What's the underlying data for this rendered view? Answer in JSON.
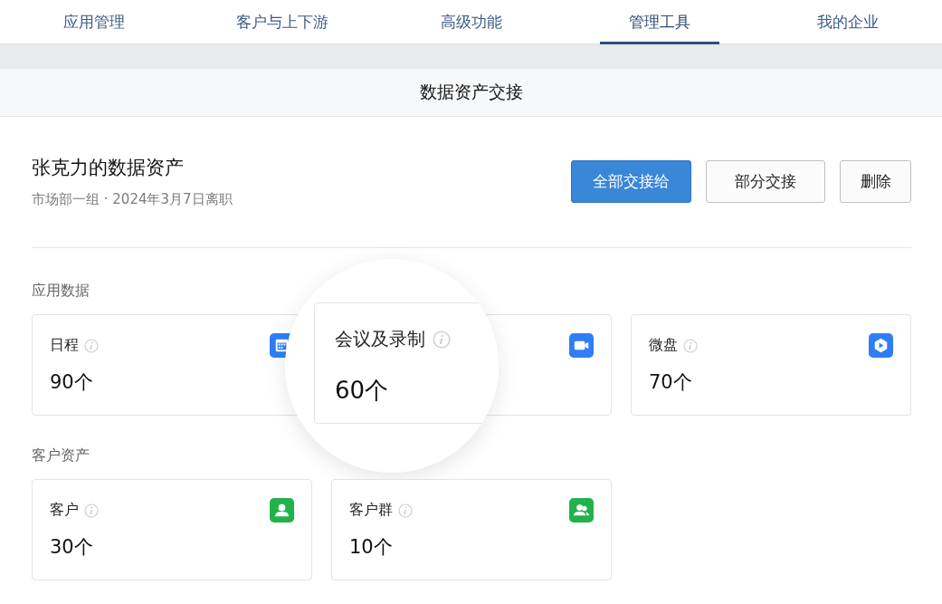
{
  "tabs": [
    {
      "label": "应用管理",
      "selected": false
    },
    {
      "label": "客户与上下游",
      "selected": false
    },
    {
      "label": "高级功能",
      "selected": false
    },
    {
      "label": "管理工具",
      "selected": true
    },
    {
      "label": "我的企业",
      "selected": false
    }
  ],
  "page_title": "数据资产交接",
  "owner": {
    "name": "张克力的数据资产",
    "subtitle": "市场部一组 · 2024年3月7日离职"
  },
  "actions": [
    {
      "label": "全部交接给",
      "kind": "primary"
    },
    {
      "label": "部分交接",
      "kind": "default"
    },
    {
      "label": "删除",
      "kind": "default"
    }
  ],
  "sections": [
    {
      "title": "应用数据",
      "cards": [
        {
          "label": "日程",
          "count": "90个",
          "kind": "calendar",
          "magnified": false
        },
        {
          "label": "会议及录制",
          "count": "60个",
          "kind": "video",
          "magnified": true
        },
        {
          "label": "微盘",
          "count": "70个",
          "kind": "drive",
          "magnified": false
        }
      ]
    },
    {
      "title": "客户资产",
      "cards": [
        {
          "label": "客户",
          "count": "30个",
          "kind": "person",
          "magnified": false
        },
        {
          "label": "客户群",
          "count": "10个",
          "kind": "people",
          "magnified": false
        }
      ]
    }
  ]
}
